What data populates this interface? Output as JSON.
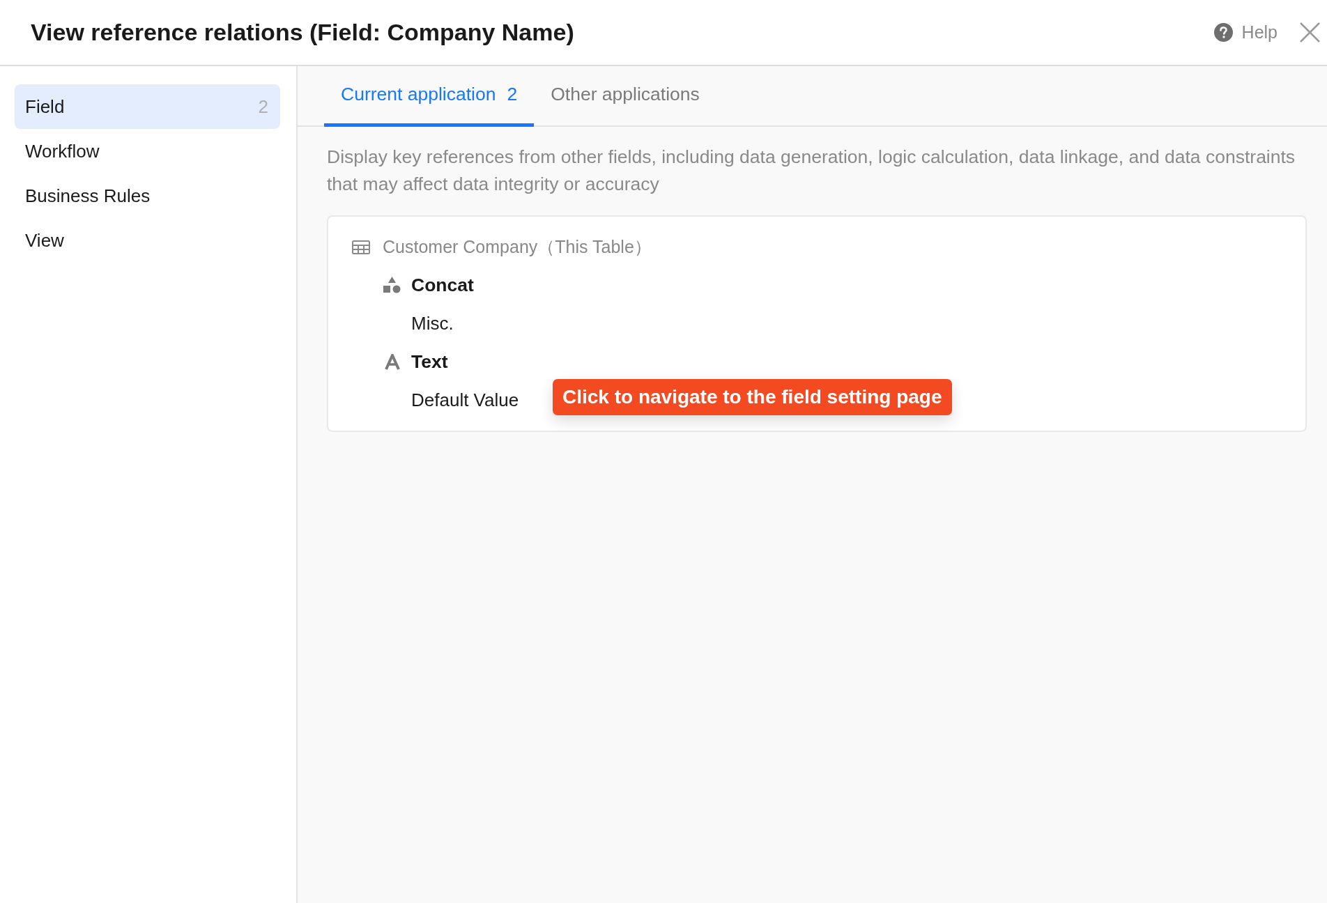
{
  "dialog": {
    "title": "View reference relations (Field: Company Name)",
    "help_label": "Help"
  },
  "sidebar": {
    "items": [
      {
        "label": "Field",
        "count": "2",
        "selected": true
      },
      {
        "label": "Workflow",
        "selected": false
      },
      {
        "label": "Business Rules",
        "selected": false
      },
      {
        "label": "View",
        "selected": false
      }
    ]
  },
  "tabs": [
    {
      "label": "Current application",
      "count": "2",
      "selected": true
    },
    {
      "label": "Other applications",
      "selected": false
    }
  ],
  "description": "Display key references from other fields, including data generation, logic calculation, data linkage, and data constraints that may affect data integrity or accuracy",
  "reference_tree": [
    {
      "label": "Customer Company（This Table）",
      "children": [
        {
          "label": "Concat",
          "kind": "shapes",
          "children": [
            {
              "label": "Misc."
            }
          ]
        },
        {
          "label": "Text",
          "kind": "text",
          "children": [
            {
              "label": "Default Value",
              "tooltip": "Click to navigate to the field setting page"
            }
          ]
        }
      ]
    }
  ]
}
